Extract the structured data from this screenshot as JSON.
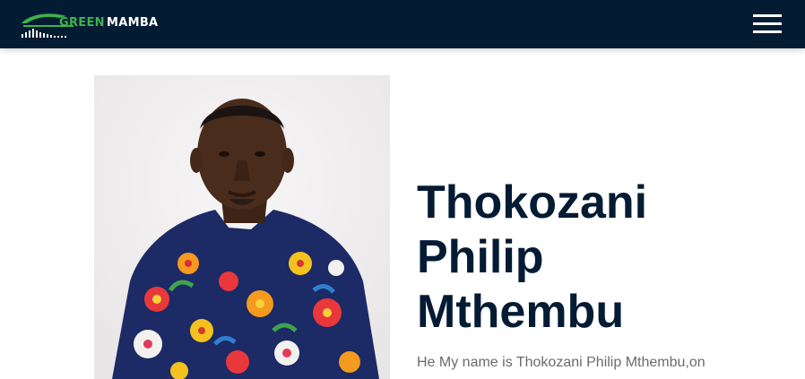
{
  "header": {
    "logo_word_1": "GREEN",
    "logo_word_2": "MAMBA",
    "menu_icon": "hamburger-menu-icon",
    "background_color": "#041b34",
    "brand_green": "#3db34a"
  },
  "profile": {
    "photo_alt": "Thokozani Philip Mthembu",
    "name_line_1": "Thokozani",
    "name_line_2": "Philip",
    "name_line_3": "Mthembu",
    "bio": "He My name is Thokozani Philip Mthembu,on",
    "name_color": "#041b34"
  }
}
